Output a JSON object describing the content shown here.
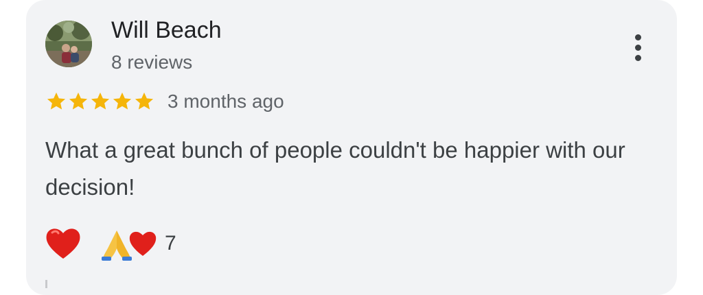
{
  "review": {
    "author_name": "Will Beach",
    "author_reviews": "8 reviews",
    "rating": 5,
    "rating_max": 5,
    "time_ago": "3 months ago",
    "text": "What a great bunch of people couldn't be happier with our decision!",
    "menu_icon": "more-vertical-icon",
    "reactions": {
      "heart_icon": "red-heart-emoji",
      "group_icons": [
        "folded-hands-emoji",
        "red-heart-emoji"
      ],
      "count": "7"
    }
  },
  "colors": {
    "card_background": "#f2f3f5",
    "star": "#f5b50a",
    "primary_text": "#202124",
    "secondary_text": "#5f6368",
    "heart": "#e0201b"
  }
}
